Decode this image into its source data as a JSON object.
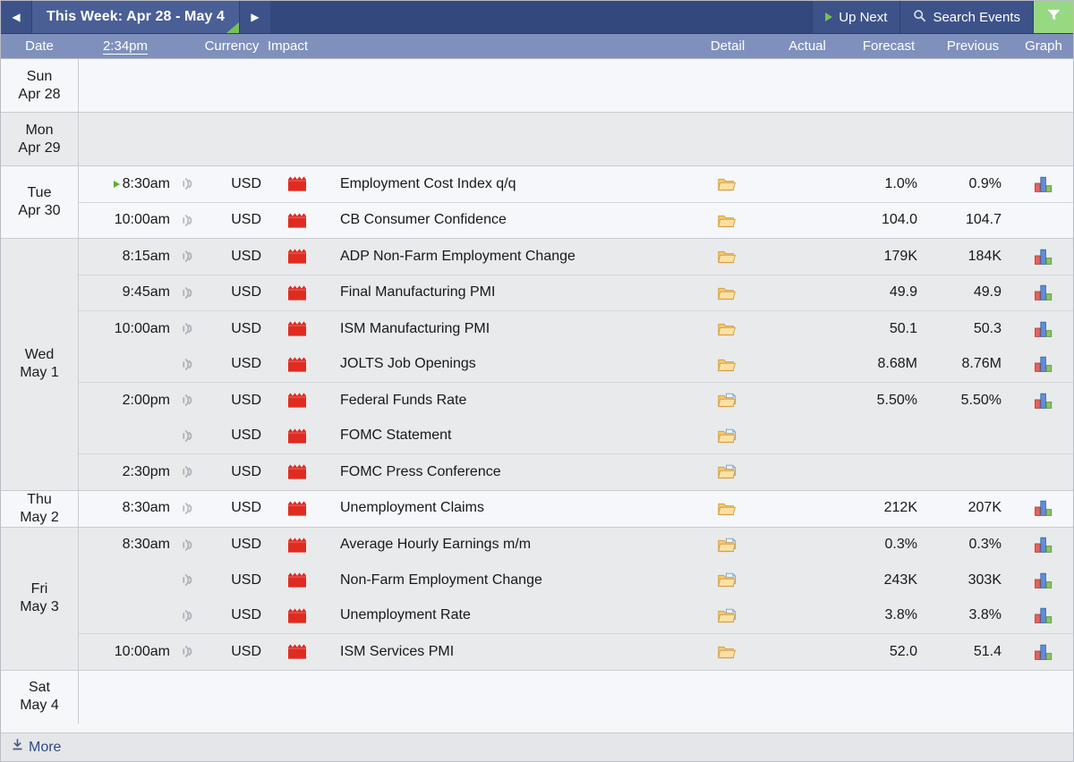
{
  "titlebar": {
    "prev_label": "◀",
    "next_label": "▶",
    "week_title": "This Week: Apr 28 - May 4",
    "up_next_label": "Up Next",
    "search_label": "Search Events",
    "filter_icon": "filter-funnel-icon"
  },
  "columns": {
    "date": "Date",
    "time": "2:34pm",
    "currency": "Currency",
    "impact": "Impact",
    "detail": "Detail",
    "actual": "Actual",
    "forecast": "Forecast",
    "previous": "Previous",
    "graph": "Graph"
  },
  "colors": {
    "titlebar": "#33487c",
    "title_tab": "#4a5f96",
    "column_header": "#8090bd",
    "accent_green": "#96d982",
    "impact_red": "#e02b20",
    "row_light": "#f6f7fa",
    "row_dark": "#e8eaec",
    "link_blue": "#2d4a86"
  },
  "days": [
    {
      "weekday": "Sun",
      "date": "Apr 28",
      "shade": "light",
      "events": []
    },
    {
      "weekday": "Mon",
      "date": "Apr 29",
      "shade": "dark",
      "events": []
    },
    {
      "weekday": "Tue",
      "date": "Apr 30",
      "shade": "light",
      "events": [
        {
          "time": "8:30am",
          "upnext": true,
          "currency": "USD",
          "impact": "high",
          "title": "Employment Cost Index q/q",
          "detail": "folder",
          "actual": "",
          "forecast": "1.0%",
          "previous": "0.9%",
          "graph": true,
          "new_time_group": true
        },
        {
          "time": "10:00am",
          "upnext": false,
          "currency": "USD",
          "impact": "high",
          "title": "CB Consumer Confidence",
          "detail": "folder",
          "actual": "",
          "forecast": "104.0",
          "previous": "104.7",
          "graph": false,
          "new_time_group": true
        }
      ]
    },
    {
      "weekday": "Wed",
      "date": "May 1",
      "shade": "dark",
      "events": [
        {
          "time": "8:15am",
          "upnext": false,
          "currency": "USD",
          "impact": "high",
          "title": "ADP Non-Farm Employment Change",
          "detail": "folder",
          "actual": "",
          "forecast": "179K",
          "previous": "184K",
          "graph": true,
          "new_time_group": true
        },
        {
          "time": "9:45am",
          "upnext": false,
          "currency": "USD",
          "impact": "high",
          "title": "Final Manufacturing PMI",
          "detail": "folder",
          "actual": "",
          "forecast": "49.9",
          "previous": "49.9",
          "graph": true,
          "new_time_group": true
        },
        {
          "time": "10:00am",
          "upnext": false,
          "currency": "USD",
          "impact": "high",
          "title": "ISM Manufacturing PMI",
          "detail": "folder",
          "actual": "",
          "forecast": "50.1",
          "previous": "50.3",
          "graph": true,
          "new_time_group": true
        },
        {
          "time": "",
          "upnext": false,
          "currency": "USD",
          "impact": "high",
          "title": "JOLTS Job Openings",
          "detail": "folder",
          "actual": "",
          "forecast": "8.68M",
          "previous": "8.76M",
          "graph": true,
          "new_time_group": false
        },
        {
          "time": "2:00pm",
          "upnext": false,
          "currency": "USD",
          "impact": "high",
          "title": "Federal Funds Rate",
          "detail": "folder-doc",
          "actual": "",
          "forecast": "5.50%",
          "previous": "5.50%",
          "graph": true,
          "new_time_group": true
        },
        {
          "time": "",
          "upnext": false,
          "currency": "USD",
          "impact": "high",
          "title": "FOMC Statement",
          "detail": "folder-doc",
          "actual": "",
          "forecast": "",
          "previous": "",
          "graph": false,
          "new_time_group": false
        },
        {
          "time": "2:30pm",
          "upnext": false,
          "currency": "USD",
          "impact": "high",
          "title": "FOMC Press Conference",
          "detail": "folder-doc",
          "actual": "",
          "forecast": "",
          "previous": "",
          "graph": false,
          "new_time_group": true
        }
      ]
    },
    {
      "weekday": "Thu",
      "date": "May 2",
      "shade": "light",
      "events": [
        {
          "time": "8:30am",
          "upnext": false,
          "currency": "USD",
          "impact": "high",
          "title": "Unemployment Claims",
          "detail": "folder",
          "actual": "",
          "forecast": "212K",
          "previous": "207K",
          "graph": true,
          "new_time_group": true
        }
      ]
    },
    {
      "weekday": "Fri",
      "date": "May 3",
      "shade": "dark",
      "events": [
        {
          "time": "8:30am",
          "upnext": false,
          "currency": "USD",
          "impact": "high",
          "title": "Average Hourly Earnings m/m",
          "detail": "folder-doc",
          "actual": "",
          "forecast": "0.3%",
          "previous": "0.3%",
          "graph": true,
          "new_time_group": true
        },
        {
          "time": "",
          "upnext": false,
          "currency": "USD",
          "impact": "high",
          "title": "Non-Farm Employment Change",
          "detail": "folder-doc",
          "actual": "",
          "forecast": "243K",
          "previous": "303K",
          "graph": true,
          "new_time_group": false
        },
        {
          "time": "",
          "upnext": false,
          "currency": "USD",
          "impact": "high",
          "title": "Unemployment Rate",
          "detail": "folder-doc",
          "actual": "",
          "forecast": "3.8%",
          "previous": "3.8%",
          "graph": true,
          "new_time_group": false
        },
        {
          "time": "10:00am",
          "upnext": false,
          "currency": "USD",
          "impact": "high",
          "title": "ISM Services PMI",
          "detail": "folder",
          "actual": "",
          "forecast": "52.0",
          "previous": "51.4",
          "graph": true,
          "new_time_group": true
        }
      ]
    },
    {
      "weekday": "Sat",
      "date": "May 4",
      "shade": "light",
      "events": []
    }
  ],
  "footer": {
    "more_label": "More",
    "more_icon": "download-arrow-icon"
  }
}
